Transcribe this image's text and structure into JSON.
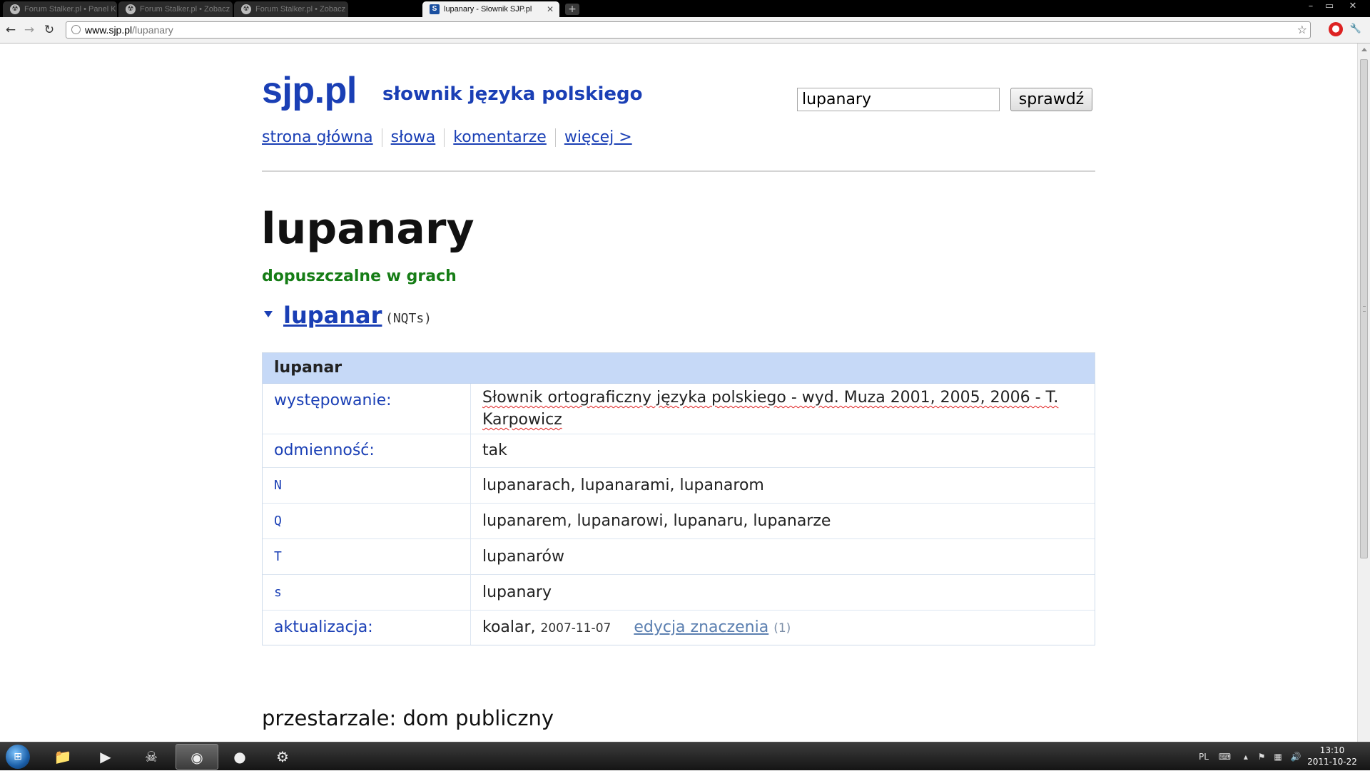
{
  "browser": {
    "tabs": [
      {
        "title": "Forum Stalker.pl • Panel K",
        "active": false
      },
      {
        "title": "Forum Stalker.pl • Zobacz",
        "active": false
      },
      {
        "title": "Forum Stalker.pl • Zobacz",
        "active": false
      },
      {
        "title": "lupanary - Słownik SJP.pl",
        "active": true,
        "favicon_letter": "S"
      }
    ],
    "new_tab": "+",
    "window_controls": {
      "minimize": "–",
      "maximize": "▭",
      "close": "✕"
    },
    "url_host": "www.sjp.pl",
    "url_path": "/lupanary",
    "icons": [
      "back-icon",
      "forward-icon",
      "reload-icon",
      "globe-icon",
      "star-icon",
      "extension-icon",
      "wrench-icon"
    ]
  },
  "site": {
    "logo": "sjp.pl",
    "tagline": "słownik języka polskiego",
    "search_value": "lupanary",
    "search_button": "sprawdź",
    "nav": [
      "strona główna",
      "słowa",
      "komentarze",
      "więcej >"
    ]
  },
  "entry": {
    "headword": "lupanary",
    "status": "dopuszczalne w grach",
    "status_color": "#167d16",
    "lemma": "lupanar",
    "flags": "(NQTs)",
    "table_title": "lupanar",
    "occurrence_label": "występowanie:",
    "occurrence_value": "Słownik ortograficzny języka polskiego - wyd. Muza 2001, 2005, 2006 - T. Karpowicz",
    "inflection_label": "odmienność:",
    "inflection_value": "tak",
    "forms": [
      {
        "code": "N",
        "value": "lupanarach, lupanarami, lupanarom"
      },
      {
        "code": "Q",
        "value": "lupanarem, lupanarowi, lupanaru, lupanarze"
      },
      {
        "code": "T",
        "value": "lupanarów"
      },
      {
        "code": "s",
        "value": "lupanary"
      }
    ],
    "update_label": "aktualizacja:",
    "update_author": "koalar,",
    "update_date": "2007-11-07",
    "edit_link": "edycja znaczenia",
    "edit_count": "(1)",
    "meaning": "przestarzale: dom publiczny"
  },
  "taskbar": {
    "language": "PL",
    "time": "13:10",
    "date": "2011-10-22"
  },
  "colors": {
    "link_blue": "#1a3fb5",
    "table_header": "#c6d9f7"
  }
}
